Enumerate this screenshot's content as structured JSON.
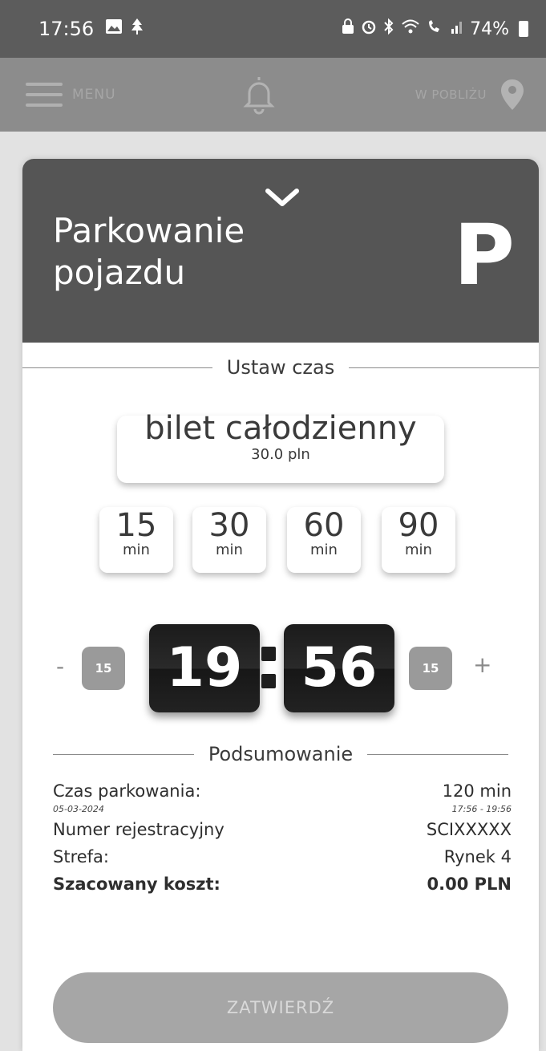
{
  "status_bar": {
    "time": "17:56",
    "battery": "74%",
    "icons_left": [
      "gallery-icon",
      "tree-icon"
    ],
    "icons_right": [
      "lock-icon",
      "alarm-icon",
      "bluetooth-icon",
      "wifi-icon",
      "volte-icon",
      "signal-icon",
      "battery-icon"
    ]
  },
  "nav": {
    "menu_label": "MENU",
    "nearby_label": "W POBLIŻU"
  },
  "card": {
    "title_line1": "Parkowanie",
    "title_line2": "pojazdu",
    "parking_symbol": "P"
  },
  "set_time": {
    "section_label": "Ustaw czas",
    "ticket_name": "bilet całodzienny",
    "ticket_price": "30.0 pln",
    "presets": [
      {
        "value": "15",
        "unit": "min"
      },
      {
        "value": "30",
        "unit": "min"
      },
      {
        "value": "60",
        "unit": "min"
      },
      {
        "value": "90",
        "unit": "min"
      }
    ],
    "minus_label": "-",
    "plus_label": "+",
    "step_minus": "15",
    "step_plus": "15",
    "clock_hours": "19",
    "clock_minutes": "56"
  },
  "summary": {
    "section_label": "Podsumowanie",
    "duration_label": "Czas parkowania:",
    "duration_value": "120 min",
    "date": "05-03-2024",
    "time_range": "17:56 - 19:56",
    "plate_label": "Numer rejestracyjny",
    "plate_value": "SCIXXXXX",
    "zone_label": "Strefa:",
    "zone_value": "Rynek 4",
    "cost_label": "Szacowany koszt:",
    "cost_value": "0.00 PLN"
  },
  "confirm_label": "ZATWIERDŹ",
  "colors": {
    "status_bar": "#5c5c5c",
    "nav_bar": "#8c8c8c",
    "card_header": "#555555",
    "clock_bg": "#1e1e1e",
    "confirm_bg": "#a6a6a6"
  }
}
